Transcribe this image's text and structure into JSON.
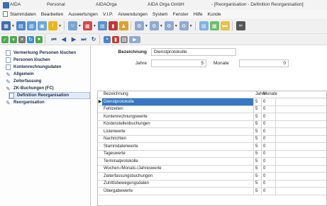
{
  "titlebar": {
    "items": [
      "AIDA",
      "Personal",
      "AIDAOrga",
      "AIDA Orga GmbH",
      "- [Reorganisation - Definition Reorganisation]"
    ]
  },
  "menubar": {
    "items": [
      "Stammdaten",
      "Bearbeiten",
      "Auswertungen",
      "V.I.P.",
      "Anwendungen",
      "System",
      "Fenster",
      "Hilfe",
      "Kunde"
    ]
  },
  "tree": {
    "items": [
      {
        "label": "Vermerkung Personen löschen"
      },
      {
        "label": "Personen löschen"
      },
      {
        "label": "Kontenrechnungsdaten"
      },
      {
        "label": "Allgemein"
      },
      {
        "label": "Zeiterfassung"
      },
      {
        "label": "ZK-Buchungen (FC)"
      },
      {
        "label": "Definition Reorganisation"
      },
      {
        "label": "Reorganisation"
      }
    ]
  },
  "form": {
    "bezeichnung_label": "Bezeichnung",
    "bezeichnung_value": "Dienstprotokolle",
    "jahre_label": "Jahre",
    "jahre_value": "5",
    "monate_label": "Monate",
    "monate_value": "0"
  },
  "table": {
    "headers": {
      "bezeichnung": "Bezeichnung",
      "jahre": "Jahre",
      "monate": "Monate"
    },
    "current_row_marker": "▶",
    "rows": [
      {
        "bezeichnung": "Dienstprotokolle",
        "jahre": "5",
        "monate": "0"
      },
      {
        "bezeichnung": "Fehlzeiten",
        "jahre": "5",
        "monate": "0"
      },
      {
        "bezeichnung": "Kontenrechnungswerte",
        "jahre": "5",
        "monate": "0"
      },
      {
        "bezeichnung": "Kostenstellenbuchungen",
        "jahre": "5",
        "monate": "0"
      },
      {
        "bezeichnung": "Listenwerte",
        "jahre": "5",
        "monate": "0"
      },
      {
        "bezeichnung": "Nachrichten",
        "jahre": "5",
        "monate": "0"
      },
      {
        "bezeichnung": "Stammdatenwerte",
        "jahre": "5",
        "monate": "0"
      },
      {
        "bezeichnung": "Tageswerte",
        "jahre": "5",
        "monate": "0"
      },
      {
        "bezeichnung": "Terminalprotokolle",
        "jahre": "5",
        "monate": "0"
      },
      {
        "bezeichnung": "Wochen-/Monats-/Jahreswerte",
        "jahre": "5",
        "monate": "0"
      },
      {
        "bezeichnung": "Zeiterfassungsbuchungen",
        "jahre": "5",
        "monate": "0"
      },
      {
        "bezeichnung": "Zutrittsbewegungsdaten",
        "jahre": "5",
        "monate": "0"
      },
      {
        "bezeichnung": "Übergabewerte",
        "jahre": "5",
        "monate": "0"
      }
    ]
  },
  "colors": {
    "selection": "#3478c6",
    "tree_selection": "#e3ebf7"
  }
}
